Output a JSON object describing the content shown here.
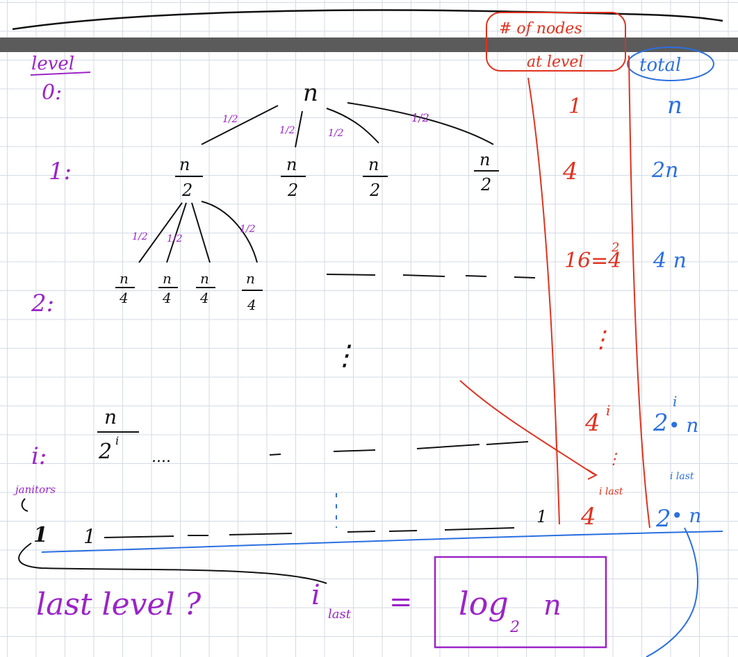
{
  "colors": {
    "black": "#111111",
    "purple": "#9b24c7",
    "red": "#e0321f",
    "blue": "#2a6fe0"
  },
  "header": {
    "level_label": "level",
    "nodes_label_line1": "# of nodes",
    "nodes_label_line2": "at level",
    "total_label": "total"
  },
  "levels": [
    {
      "label": "0:",
      "nodes": "1",
      "total": "n"
    },
    {
      "label": "1:",
      "nodes": "4",
      "total": "2n"
    },
    {
      "label": "2:",
      "nodes": "16=4",
      "nodes_sup": "2",
      "total": "4 n"
    },
    {
      "label": "i:",
      "nodes": "4",
      "nodes_sup": "i",
      "total": "2",
      "total_sup": "i",
      "total_tail": "• n"
    },
    {
      "label": "",
      "nodes": "4",
      "nodes_sup": "i last",
      "total": "2",
      "total_sup": "i last",
      "total_tail": "• n"
    }
  ],
  "tree": {
    "root": "n",
    "level1": {
      "num": "n",
      "den": "2"
    },
    "level2": {
      "num": "n",
      "den": "4"
    },
    "leveli": {
      "num": "n",
      "den": "2",
      "den_sup": "i"
    },
    "edge_weight": "1/2",
    "dots": "....",
    "vdots": "⋮",
    "leaf": "1"
  },
  "bottom": {
    "janitors_label": "janitors",
    "leaves": [
      "1",
      "1"
    ],
    "question": "last level ?",
    "i_last": "i",
    "i_last_sub": "last",
    "equals": "=",
    "answer": "log",
    "answer_sub": "2",
    "answer_tail": "n"
  }
}
